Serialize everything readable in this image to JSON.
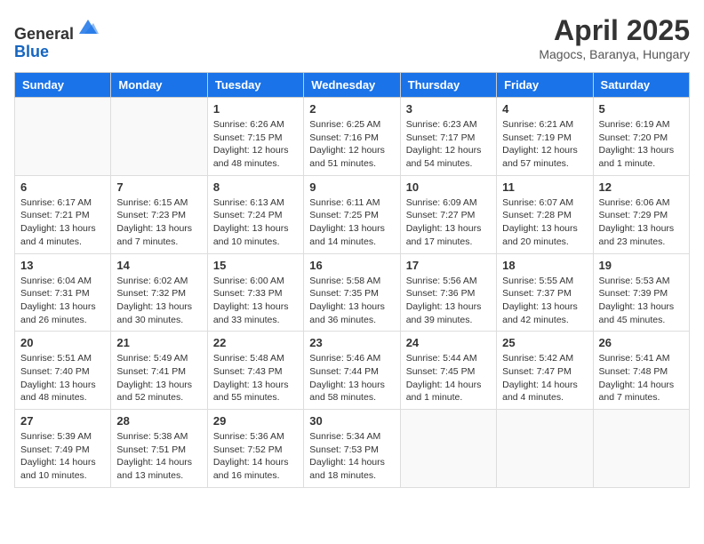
{
  "header": {
    "logo_line1": "General",
    "logo_line2": "Blue",
    "title": "April 2025",
    "subtitle": "Magocs, Baranya, Hungary"
  },
  "weekdays": [
    "Sunday",
    "Monday",
    "Tuesday",
    "Wednesday",
    "Thursday",
    "Friday",
    "Saturday"
  ],
  "weeks": [
    [
      {
        "day": "",
        "info": ""
      },
      {
        "day": "",
        "info": ""
      },
      {
        "day": "1",
        "info": "Sunrise: 6:26 AM\nSunset: 7:15 PM\nDaylight: 12 hours and 48 minutes."
      },
      {
        "day": "2",
        "info": "Sunrise: 6:25 AM\nSunset: 7:16 PM\nDaylight: 12 hours and 51 minutes."
      },
      {
        "day": "3",
        "info": "Sunrise: 6:23 AM\nSunset: 7:17 PM\nDaylight: 12 hours and 54 minutes."
      },
      {
        "day": "4",
        "info": "Sunrise: 6:21 AM\nSunset: 7:19 PM\nDaylight: 12 hours and 57 minutes."
      },
      {
        "day": "5",
        "info": "Sunrise: 6:19 AM\nSunset: 7:20 PM\nDaylight: 13 hours and 1 minute."
      }
    ],
    [
      {
        "day": "6",
        "info": "Sunrise: 6:17 AM\nSunset: 7:21 PM\nDaylight: 13 hours and 4 minutes."
      },
      {
        "day": "7",
        "info": "Sunrise: 6:15 AM\nSunset: 7:23 PM\nDaylight: 13 hours and 7 minutes."
      },
      {
        "day": "8",
        "info": "Sunrise: 6:13 AM\nSunset: 7:24 PM\nDaylight: 13 hours and 10 minutes."
      },
      {
        "day": "9",
        "info": "Sunrise: 6:11 AM\nSunset: 7:25 PM\nDaylight: 13 hours and 14 minutes."
      },
      {
        "day": "10",
        "info": "Sunrise: 6:09 AM\nSunset: 7:27 PM\nDaylight: 13 hours and 17 minutes."
      },
      {
        "day": "11",
        "info": "Sunrise: 6:07 AM\nSunset: 7:28 PM\nDaylight: 13 hours and 20 minutes."
      },
      {
        "day": "12",
        "info": "Sunrise: 6:06 AM\nSunset: 7:29 PM\nDaylight: 13 hours and 23 minutes."
      }
    ],
    [
      {
        "day": "13",
        "info": "Sunrise: 6:04 AM\nSunset: 7:31 PM\nDaylight: 13 hours and 26 minutes."
      },
      {
        "day": "14",
        "info": "Sunrise: 6:02 AM\nSunset: 7:32 PM\nDaylight: 13 hours and 30 minutes."
      },
      {
        "day": "15",
        "info": "Sunrise: 6:00 AM\nSunset: 7:33 PM\nDaylight: 13 hours and 33 minutes."
      },
      {
        "day": "16",
        "info": "Sunrise: 5:58 AM\nSunset: 7:35 PM\nDaylight: 13 hours and 36 minutes."
      },
      {
        "day": "17",
        "info": "Sunrise: 5:56 AM\nSunset: 7:36 PM\nDaylight: 13 hours and 39 minutes."
      },
      {
        "day": "18",
        "info": "Sunrise: 5:55 AM\nSunset: 7:37 PM\nDaylight: 13 hours and 42 minutes."
      },
      {
        "day": "19",
        "info": "Sunrise: 5:53 AM\nSunset: 7:39 PM\nDaylight: 13 hours and 45 minutes."
      }
    ],
    [
      {
        "day": "20",
        "info": "Sunrise: 5:51 AM\nSunset: 7:40 PM\nDaylight: 13 hours and 48 minutes."
      },
      {
        "day": "21",
        "info": "Sunrise: 5:49 AM\nSunset: 7:41 PM\nDaylight: 13 hours and 52 minutes."
      },
      {
        "day": "22",
        "info": "Sunrise: 5:48 AM\nSunset: 7:43 PM\nDaylight: 13 hours and 55 minutes."
      },
      {
        "day": "23",
        "info": "Sunrise: 5:46 AM\nSunset: 7:44 PM\nDaylight: 13 hours and 58 minutes."
      },
      {
        "day": "24",
        "info": "Sunrise: 5:44 AM\nSunset: 7:45 PM\nDaylight: 14 hours and 1 minute."
      },
      {
        "day": "25",
        "info": "Sunrise: 5:42 AM\nSunset: 7:47 PM\nDaylight: 14 hours and 4 minutes."
      },
      {
        "day": "26",
        "info": "Sunrise: 5:41 AM\nSunset: 7:48 PM\nDaylight: 14 hours and 7 minutes."
      }
    ],
    [
      {
        "day": "27",
        "info": "Sunrise: 5:39 AM\nSunset: 7:49 PM\nDaylight: 14 hours and 10 minutes."
      },
      {
        "day": "28",
        "info": "Sunrise: 5:38 AM\nSunset: 7:51 PM\nDaylight: 14 hours and 13 minutes."
      },
      {
        "day": "29",
        "info": "Sunrise: 5:36 AM\nSunset: 7:52 PM\nDaylight: 14 hours and 16 minutes."
      },
      {
        "day": "30",
        "info": "Sunrise: 5:34 AM\nSunset: 7:53 PM\nDaylight: 14 hours and 18 minutes."
      },
      {
        "day": "",
        "info": ""
      },
      {
        "day": "",
        "info": ""
      },
      {
        "day": "",
        "info": ""
      }
    ]
  ]
}
